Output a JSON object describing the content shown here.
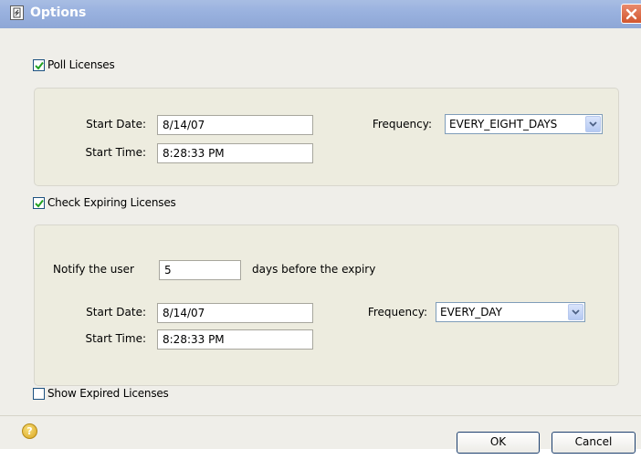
{
  "window": {
    "title": "Options"
  },
  "poll": {
    "checkbox_label": "Poll Licenses",
    "checked": true,
    "start_date_label": "Start Date:",
    "start_date": "8/14/07",
    "start_time_label": "Start Time:",
    "start_time": "8:28:33 PM",
    "frequency_label": "Frequency:",
    "frequency": "EVERY_EIGHT_DAYS"
  },
  "expiring": {
    "checkbox_label": "Check Expiring Licenses",
    "checked": true,
    "notify_label": "Notify the user",
    "notify_days": "5",
    "notify_suffix": "days before the expiry",
    "start_date_label": "Start Date:",
    "start_date": "8/14/07",
    "start_time_label": "Start Time:",
    "start_time": "8:28:33 PM",
    "frequency_label": "Frequency:",
    "frequency": "EVERY_DAY"
  },
  "expired": {
    "checkbox_label": "Show Expired Licenses",
    "checked": false
  },
  "footer": {
    "help_glyph": "?",
    "ok_label": "OK",
    "cancel_label": "Cancel"
  },
  "icons": {
    "title": "options-window-icon",
    "close": "close-icon",
    "help": "help-icon",
    "dropdown": "chevron-down-icon",
    "check": "checkmark-icon"
  },
  "colors": {
    "titlebar": "#9ab2df",
    "close": "#d2562e",
    "dialog_bg": "#efeee9",
    "group_border": "#d8d6cd",
    "check": "#21a121"
  }
}
